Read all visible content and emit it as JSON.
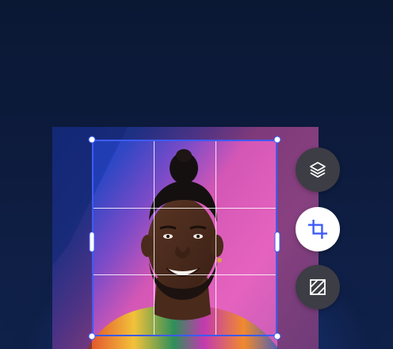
{
  "app": {
    "mode": "crop",
    "accent_color": "#3d5bf5"
  },
  "image": {
    "subject": "portrait-photo"
  },
  "crop": {
    "grid": "rule-of-thirds"
  },
  "toolbar": {
    "buttons": [
      {
        "icon": "layers-icon",
        "active": false
      },
      {
        "icon": "crop-icon",
        "active": true
      },
      {
        "icon": "adjust-pattern-icon",
        "active": false
      }
    ]
  }
}
